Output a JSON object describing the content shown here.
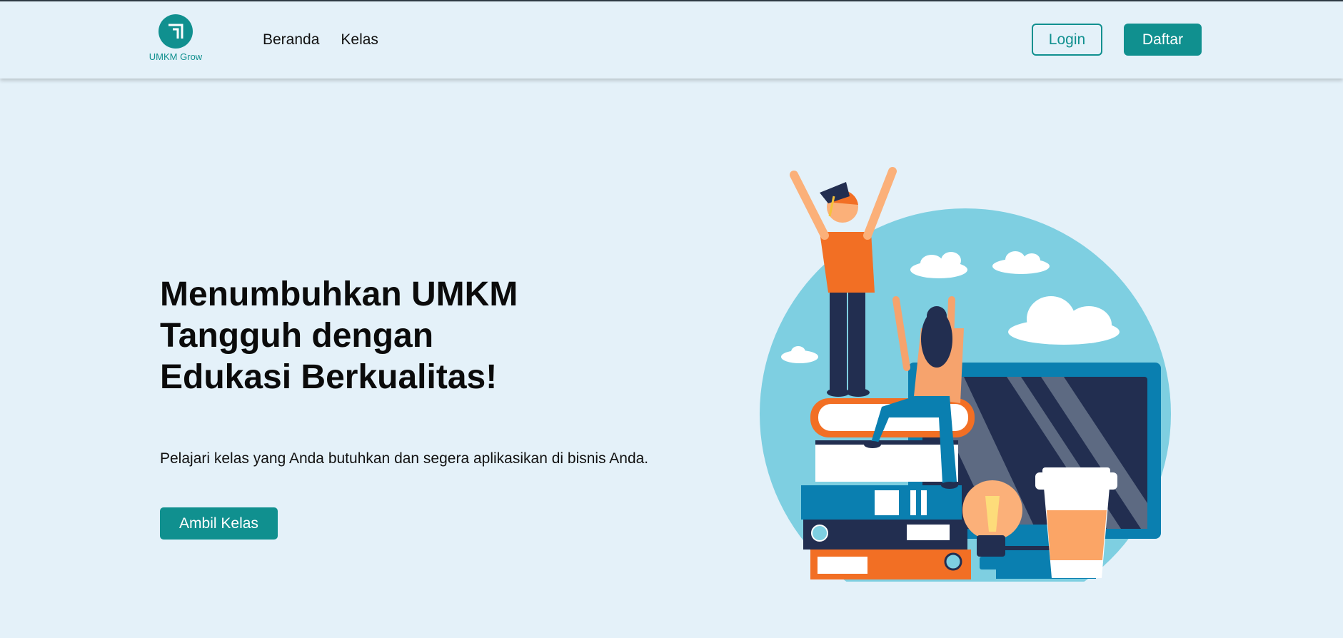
{
  "brand": {
    "name": "UMKM Grow",
    "color": "#10908f"
  },
  "nav": {
    "links": [
      "Beranda",
      "Kelas"
    ]
  },
  "auth": {
    "login_label": "Login",
    "register_label": "Daftar"
  },
  "hero": {
    "title_lines": [
      "Menumbuhkan UMKM",
      "Tangguh dengan",
      "Edukasi Berkualitas!"
    ],
    "subtitle": "Pelajari kelas yang Anda butuhkan dan segera aplikasikan di bisnis Anda.",
    "cta_label": "Ambil Kelas"
  },
  "illustration": {
    "icon": "graduation-study-illustration",
    "colors": {
      "circle": "#7ecfe1",
      "orange": "#f26f24",
      "navy": "#222e50",
      "blue": "#0a7fb0"
    }
  }
}
